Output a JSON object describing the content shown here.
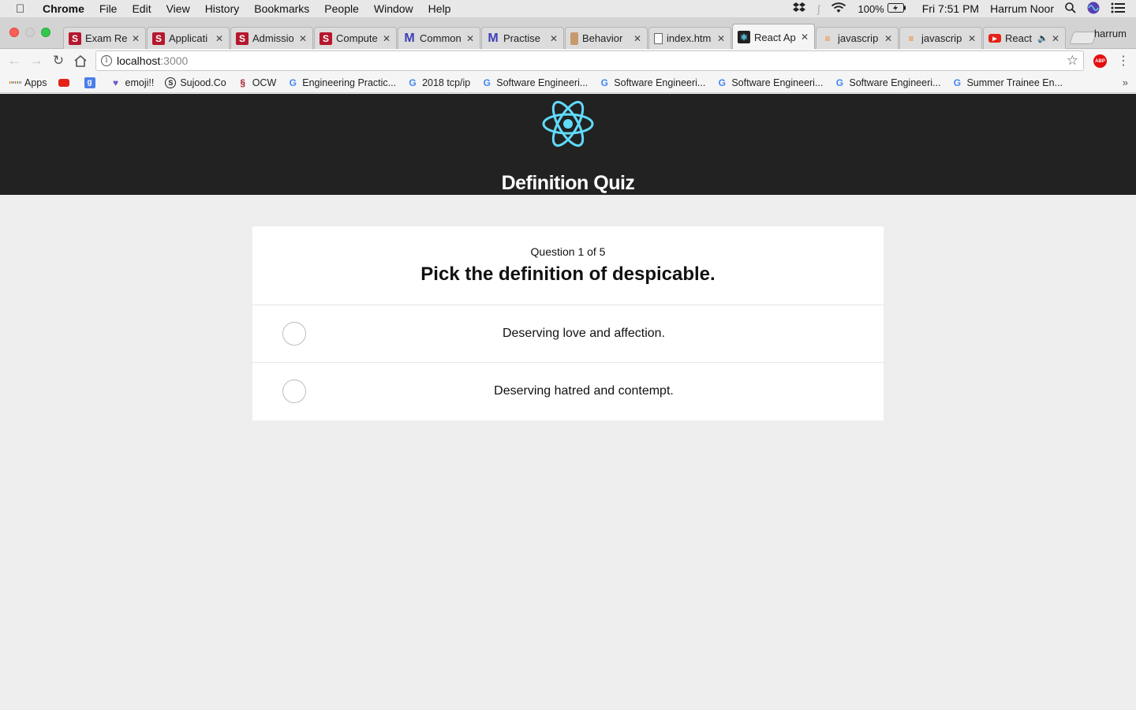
{
  "menubar": {
    "app_name": "Chrome",
    "items": [
      "File",
      "Edit",
      "View",
      "History",
      "Bookmarks",
      "People",
      "Window",
      "Help"
    ],
    "battery": "100%",
    "clock": "Fri 7:51 PM",
    "user": "Harrum Noor"
  },
  "tabs": [
    {
      "title": "Exam Re",
      "icon": "s-icon"
    },
    {
      "title": "Applicati",
      "icon": "s-icon"
    },
    {
      "title": "Admissio",
      "icon": "s-icon"
    },
    {
      "title": "Compute",
      "icon": "s-icon"
    },
    {
      "title": "Common",
      "icon": "m-icon"
    },
    {
      "title": "Practise",
      "icon": "m-icon"
    },
    {
      "title": "Behavior",
      "icon": "behavior-icon"
    },
    {
      "title": "index.htm",
      "icon": "document-icon"
    },
    {
      "title": "React Ap",
      "icon": "react-icon",
      "active": true
    },
    {
      "title": "javascrip",
      "icon": "stackoverflow-icon"
    },
    {
      "title": "javascrip",
      "icon": "stackoverflow-icon"
    },
    {
      "title": "React",
      "icon": "youtube-icon"
    }
  ],
  "profile": "harrum",
  "omnibox": {
    "host": "localhost",
    "port": ":3000"
  },
  "bookmarks": [
    {
      "label": "Apps"
    },
    {
      "label": ""
    },
    {
      "label": ""
    },
    {
      "label": "emoji!!"
    },
    {
      "label": "Sujood.Co"
    },
    {
      "label": "OCW"
    },
    {
      "label": "Engineering Practic..."
    },
    {
      "label": "2018 tcp/ip"
    },
    {
      "label": "Software Engineeri..."
    },
    {
      "label": "Software Engineeri..."
    },
    {
      "label": "Software Engineeri..."
    },
    {
      "label": "Software Engineeri..."
    },
    {
      "label": "Summer Trainee En..."
    }
  ],
  "app": {
    "title": "Definition Quiz",
    "brand_color": "#61dafb",
    "header_color": "#222222"
  },
  "quiz": {
    "counter_prefix": "Question",
    "current": "1",
    "counter_of": "of",
    "total": "5",
    "counter_text": "Question 1 of 5",
    "question": "Pick the definition of despicable.",
    "answers": [
      {
        "label": "Deserving love and affection."
      },
      {
        "label": "Deserving hatred and contempt."
      }
    ]
  }
}
